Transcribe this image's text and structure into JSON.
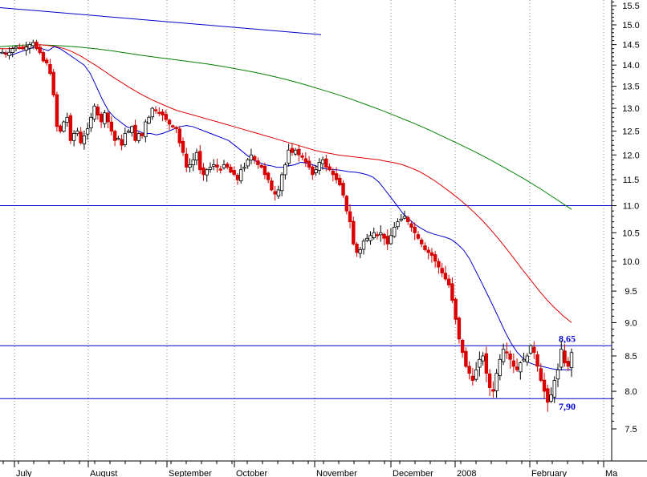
{
  "chart_data": {
    "type": "candlestick",
    "title": "",
    "xlabel": "",
    "ylabel": "",
    "y_scale": "log",
    "ylim": [
      7.05,
      15.7
    ],
    "y_ticks": [
      "7.5",
      "8.0",
      "8.5",
      "9.0",
      "9.5",
      "10.0",
      "10.5",
      "11.0",
      "11.5",
      "12.0",
      "12.5",
      "13.0",
      "13.5",
      "14.0",
      "14.5",
      "15.0",
      "15.5"
    ],
    "month_labels": [
      "July",
      "August",
      "September",
      "October",
      "November",
      "December",
      "2008",
      "February",
      "Ma"
    ],
    "grid": "vertical dotted month lines",
    "horizontal_levels": [
      {
        "value": 11.0,
        "label": "11.0"
      },
      {
        "value": 8.65,
        "label": "8,65"
      },
      {
        "value": 7.9,
        "label": "7,90"
      }
    ],
    "trendline": {
      "from": 15.45,
      "to": 14.75
    },
    "series": [
      {
        "values": [
          14.3,
          14.3,
          14.25,
          14.3,
          14.35,
          14.4,
          14.45,
          14.4,
          14.35,
          14.45,
          14.4,
          14.3,
          14.2,
          14.1,
          14.0,
          13.8,
          13.5,
          13.2,
          12.95,
          12.8,
          12.7,
          12.6,
          12.55,
          12.5,
          12.45,
          12.45,
          12.42,
          12.45,
          12.5,
          12.55,
          12.6,
          12.62,
          12.6,
          12.55,
          12.5,
          12.45,
          12.4,
          12.35,
          12.3,
          12.2,
          12.1,
          12.0,
          11.9,
          11.85,
          11.8,
          11.78,
          11.75,
          11.75,
          11.78,
          11.8,
          11.85,
          11.83,
          11.8,
          11.75,
          11.72,
          11.7,
          11.7,
          11.68,
          11.66,
          11.65,
          11.63,
          11.6,
          11.55,
          11.45,
          11.3,
          11.15,
          11.0,
          10.85,
          10.75,
          10.65,
          10.58,
          10.52,
          10.48,
          10.45,
          10.42,
          10.38,
          10.3,
          10.2,
          10.05,
          9.85,
          9.65,
          9.45,
          9.25,
          9.05,
          8.85,
          8.68,
          8.55,
          8.46,
          8.4,
          8.37,
          8.35,
          8.33,
          8.31,
          8.3,
          8.3,
          8.3
        ]
      },
      {
        "values": [
          14.4,
          14.4,
          14.42,
          14.45,
          14.48,
          14.5,
          14.48,
          14.45,
          14.4,
          14.32,
          14.22,
          14.1,
          13.98,
          13.85,
          13.72,
          13.6,
          13.48,
          13.37,
          13.27,
          13.18,
          13.1,
          13.02,
          12.95,
          12.9,
          12.85,
          12.8,
          12.75,
          12.7,
          12.65,
          12.6,
          12.55,
          12.5,
          12.45,
          12.4,
          12.35,
          12.3,
          12.25,
          12.2,
          12.15,
          12.1,
          12.06,
          12.03,
          12.0,
          11.98,
          11.96,
          11.94,
          11.92,
          11.9,
          11.87,
          11.84,
          11.8,
          11.74,
          11.67,
          11.58,
          11.48,
          11.37,
          11.25,
          11.13,
          11.0,
          10.86,
          10.71,
          10.55,
          10.38,
          10.2,
          10.02,
          9.84,
          9.67,
          9.5,
          9.35,
          9.22,
          9.1,
          9.0
        ]
      },
      {
        "values": [
          14.45,
          14.48,
          14.5,
          14.49,
          14.47,
          14.44,
          14.4,
          14.35,
          14.29,
          14.23,
          14.18,
          14.13,
          14.08,
          14.03,
          13.97,
          13.9,
          13.83,
          13.75,
          13.66,
          13.56,
          13.45,
          13.34,
          13.22,
          13.09,
          12.96,
          12.82,
          12.68,
          12.53,
          12.37,
          12.21,
          12.05,
          11.88,
          11.7,
          11.52,
          11.33,
          11.13,
          10.93
        ]
      },
      {
        "values": [
          14.31,
          14.26,
          14.31,
          14.4,
          14.45,
          14.42,
          14.4,
          14.44,
          14.5,
          14.55,
          14.4,
          14.3,
          14.1,
          14.05,
          13.8,
          13.3,
          12.6,
          12.5,
          12.7,
          12.8,
          12.3,
          12.45,
          12.5,
          12.25,
          12.4,
          12.55,
          12.8,
          13.05,
          12.85,
          12.7,
          12.9,
          12.7,
          12.5,
          12.3,
          12.35,
          12.2,
          12.45,
          12.5,
          12.6,
          12.3,
          12.45,
          12.4,
          12.7,
          12.8,
          13.0,
          12.95,
          12.9,
          12.85,
          12.75,
          12.65,
          12.6,
          12.55,
          12.25,
          12.05,
          11.75,
          11.8,
          11.9,
          12.05,
          11.7,
          11.6,
          11.7,
          11.75,
          11.8,
          11.75,
          11.7,
          11.8,
          11.75,
          11.65,
          11.6,
          11.5,
          11.7,
          11.75,
          11.9,
          12.0,
          11.9,
          11.8,
          11.75,
          11.6,
          11.5,
          11.3,
          11.22,
          11.3,
          11.6,
          11.8,
          12.1,
          12.05,
          12.1,
          12.0,
          11.95,
          11.85,
          11.75,
          11.6,
          11.7,
          11.85,
          11.9,
          11.75,
          11.7,
          11.6,
          11.5,
          11.4,
          11.2,
          10.9,
          10.7,
          10.3,
          10.15,
          10.2,
          10.35,
          10.4,
          10.45,
          10.5,
          10.45,
          10.5,
          10.4,
          10.3,
          10.45,
          10.6,
          10.7,
          10.75,
          10.8,
          10.7,
          10.6,
          10.5,
          10.4,
          10.3,
          10.2,
          10.15,
          10.1,
          10.0,
          9.9,
          9.8,
          9.7,
          9.6,
          9.35,
          9.05,
          8.75,
          8.55,
          8.35,
          8.25,
          8.15,
          8.3,
          8.45,
          8.5,
          8.25,
          8.05,
          8.0,
          8.25,
          8.45,
          8.6,
          8.55,
          8.45,
          8.35,
          8.3,
          8.4,
          8.45,
          8.5,
          8.65,
          8.55,
          8.35,
          8.15,
          8.0,
          7.85,
          7.95,
          8.15,
          8.3,
          8.6,
          8.4,
          8.35,
          8.55
        ]
      }
    ]
  }
}
